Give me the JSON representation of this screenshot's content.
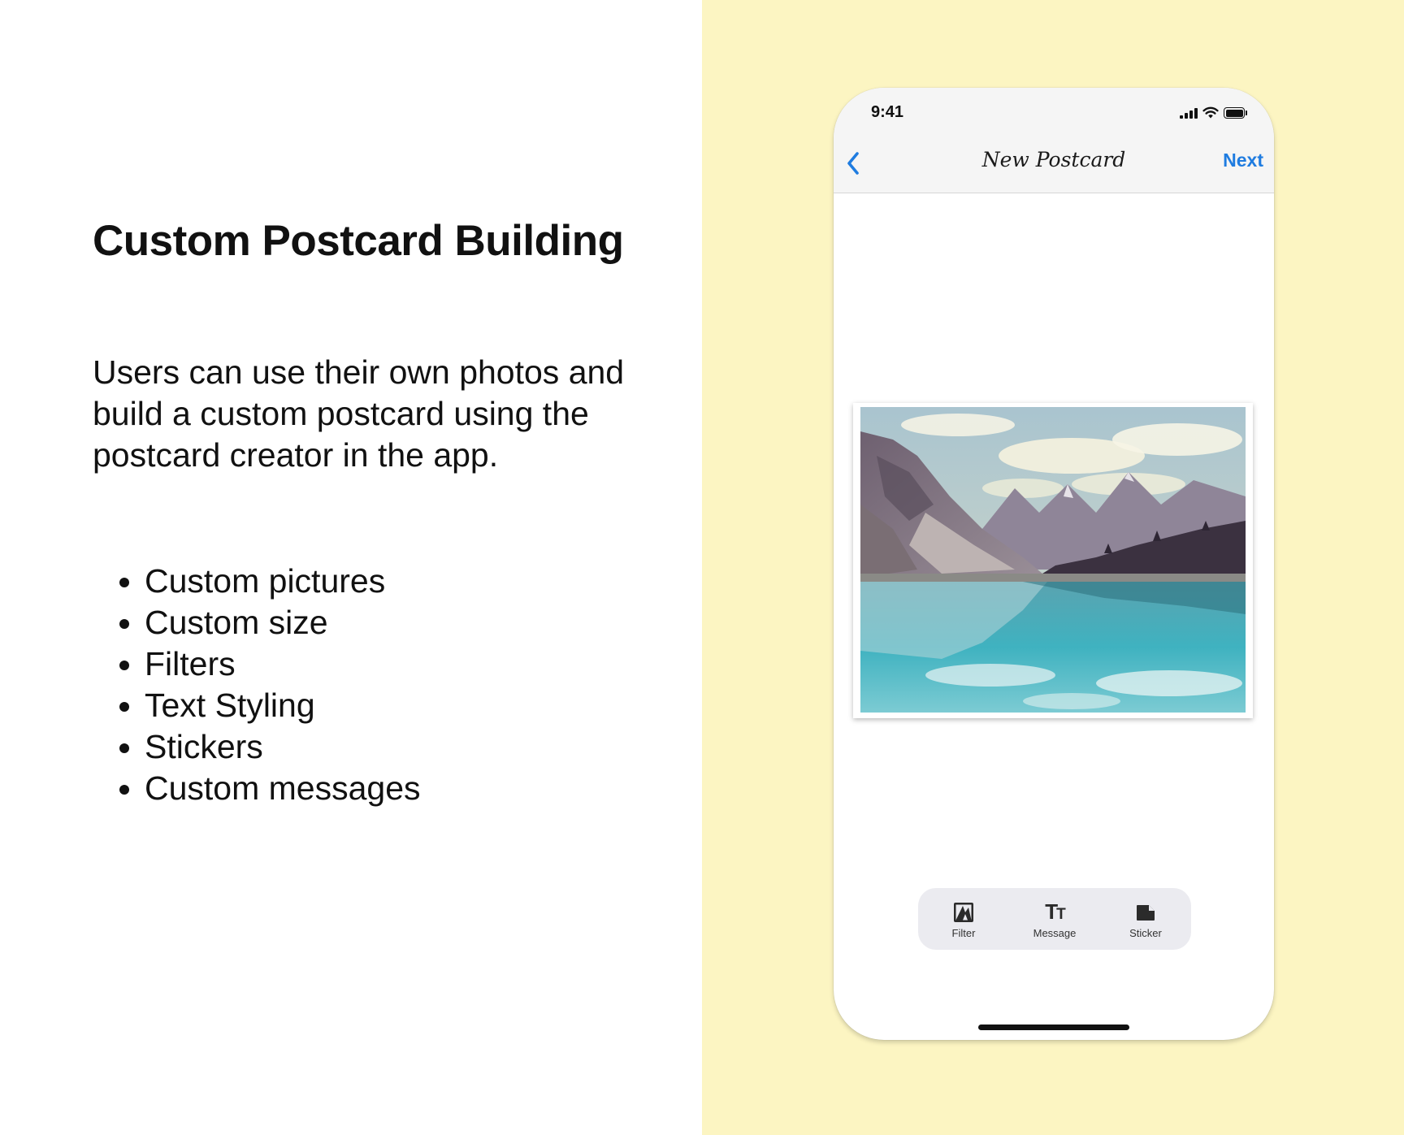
{
  "slide": {
    "title": "Custom Postcard Building",
    "description": "Users can use their own photos and build a custom postcard using the postcard creator in the app.",
    "features": [
      "Custom pictures",
      "Custom size",
      "Filters",
      "Text Styling",
      "Stickers",
      "Custom messages"
    ],
    "background_color": "#fcf5c2"
  },
  "phone": {
    "status_bar": {
      "time": "9:41"
    },
    "nav": {
      "back_icon": "chevron-left-icon",
      "title": "New Postcard",
      "next_label": "Next",
      "accent_color": "#1f7ce0"
    },
    "postcard": {
      "photo_icon": "mountain-lake-photo"
    },
    "toolbar": {
      "items": [
        {
          "label": "Filter",
          "icon": "filter-icon"
        },
        {
          "label": "Message",
          "icon": "text-style-icon"
        },
        {
          "label": "Sticker",
          "icon": "sticker-icon"
        }
      ]
    }
  }
}
